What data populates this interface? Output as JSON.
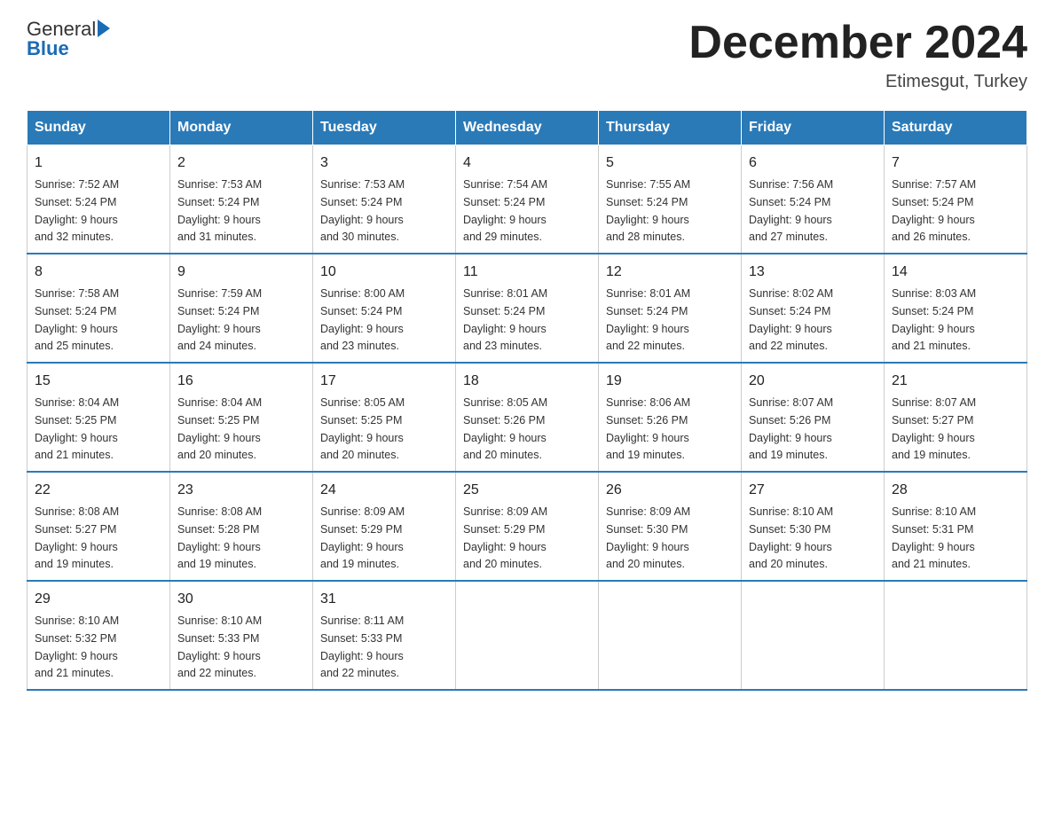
{
  "header": {
    "logo_general": "General",
    "logo_blue": "Blue",
    "month_title": "December 2024",
    "subtitle": "Etimesgut, Turkey"
  },
  "days_of_week": [
    "Sunday",
    "Monday",
    "Tuesday",
    "Wednesday",
    "Thursday",
    "Friday",
    "Saturday"
  ],
  "weeks": [
    [
      {
        "day": "1",
        "sunrise": "7:52 AM",
        "sunset": "5:24 PM",
        "daylight": "9 hours and 32 minutes."
      },
      {
        "day": "2",
        "sunrise": "7:53 AM",
        "sunset": "5:24 PM",
        "daylight": "9 hours and 31 minutes."
      },
      {
        "day": "3",
        "sunrise": "7:53 AM",
        "sunset": "5:24 PM",
        "daylight": "9 hours and 30 minutes."
      },
      {
        "day": "4",
        "sunrise": "7:54 AM",
        "sunset": "5:24 PM",
        "daylight": "9 hours and 29 minutes."
      },
      {
        "day": "5",
        "sunrise": "7:55 AM",
        "sunset": "5:24 PM",
        "daylight": "9 hours and 28 minutes."
      },
      {
        "day": "6",
        "sunrise": "7:56 AM",
        "sunset": "5:24 PM",
        "daylight": "9 hours and 27 minutes."
      },
      {
        "day": "7",
        "sunrise": "7:57 AM",
        "sunset": "5:24 PM",
        "daylight": "9 hours and 26 minutes."
      }
    ],
    [
      {
        "day": "8",
        "sunrise": "7:58 AM",
        "sunset": "5:24 PM",
        "daylight": "9 hours and 25 minutes."
      },
      {
        "day": "9",
        "sunrise": "7:59 AM",
        "sunset": "5:24 PM",
        "daylight": "9 hours and 24 minutes."
      },
      {
        "day": "10",
        "sunrise": "8:00 AM",
        "sunset": "5:24 PM",
        "daylight": "9 hours and 23 minutes."
      },
      {
        "day": "11",
        "sunrise": "8:01 AM",
        "sunset": "5:24 PM",
        "daylight": "9 hours and 23 minutes."
      },
      {
        "day": "12",
        "sunrise": "8:01 AM",
        "sunset": "5:24 PM",
        "daylight": "9 hours and 22 minutes."
      },
      {
        "day": "13",
        "sunrise": "8:02 AM",
        "sunset": "5:24 PM",
        "daylight": "9 hours and 22 minutes."
      },
      {
        "day": "14",
        "sunrise": "8:03 AM",
        "sunset": "5:24 PM",
        "daylight": "9 hours and 21 minutes."
      }
    ],
    [
      {
        "day": "15",
        "sunrise": "8:04 AM",
        "sunset": "5:25 PM",
        "daylight": "9 hours and 21 minutes."
      },
      {
        "day": "16",
        "sunrise": "8:04 AM",
        "sunset": "5:25 PM",
        "daylight": "9 hours and 20 minutes."
      },
      {
        "day": "17",
        "sunrise": "8:05 AM",
        "sunset": "5:25 PM",
        "daylight": "9 hours and 20 minutes."
      },
      {
        "day": "18",
        "sunrise": "8:05 AM",
        "sunset": "5:26 PM",
        "daylight": "9 hours and 20 minutes."
      },
      {
        "day": "19",
        "sunrise": "8:06 AM",
        "sunset": "5:26 PM",
        "daylight": "9 hours and 19 minutes."
      },
      {
        "day": "20",
        "sunrise": "8:07 AM",
        "sunset": "5:26 PM",
        "daylight": "9 hours and 19 minutes."
      },
      {
        "day": "21",
        "sunrise": "8:07 AM",
        "sunset": "5:27 PM",
        "daylight": "9 hours and 19 minutes."
      }
    ],
    [
      {
        "day": "22",
        "sunrise": "8:08 AM",
        "sunset": "5:27 PM",
        "daylight": "9 hours and 19 minutes."
      },
      {
        "day": "23",
        "sunrise": "8:08 AM",
        "sunset": "5:28 PM",
        "daylight": "9 hours and 19 minutes."
      },
      {
        "day": "24",
        "sunrise": "8:09 AM",
        "sunset": "5:29 PM",
        "daylight": "9 hours and 19 minutes."
      },
      {
        "day": "25",
        "sunrise": "8:09 AM",
        "sunset": "5:29 PM",
        "daylight": "9 hours and 20 minutes."
      },
      {
        "day": "26",
        "sunrise": "8:09 AM",
        "sunset": "5:30 PM",
        "daylight": "9 hours and 20 minutes."
      },
      {
        "day": "27",
        "sunrise": "8:10 AM",
        "sunset": "5:30 PM",
        "daylight": "9 hours and 20 minutes."
      },
      {
        "day": "28",
        "sunrise": "8:10 AM",
        "sunset": "5:31 PM",
        "daylight": "9 hours and 21 minutes."
      }
    ],
    [
      {
        "day": "29",
        "sunrise": "8:10 AM",
        "sunset": "5:32 PM",
        "daylight": "9 hours and 21 minutes."
      },
      {
        "day": "30",
        "sunrise": "8:10 AM",
        "sunset": "5:33 PM",
        "daylight": "9 hours and 22 minutes."
      },
      {
        "day": "31",
        "sunrise": "8:11 AM",
        "sunset": "5:33 PM",
        "daylight": "9 hours and 22 minutes."
      },
      null,
      null,
      null,
      null
    ]
  ]
}
